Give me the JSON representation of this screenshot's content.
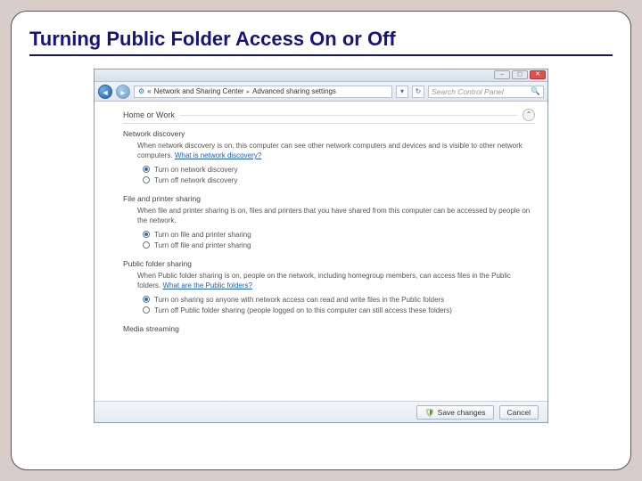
{
  "slide": {
    "title": "Turning Public Folder Access On or Off"
  },
  "toolbar": {
    "crumb_prefix": "«",
    "crumb_1": "Network and Sharing Center",
    "crumb_2": "Advanced sharing settings",
    "search_placeholder": "Search Control Panel"
  },
  "profile": {
    "name": "Home or Work"
  },
  "sections": {
    "discovery": {
      "title": "Network discovery",
      "desc": "When network discovery is on, this computer can see other network computers and devices and is visible to other network computers.",
      "link": "What is network discovery?",
      "opt_on": "Turn on network discovery",
      "opt_off": "Turn off network discovery"
    },
    "fileprint": {
      "title": "File and printer sharing",
      "desc": "When file and printer sharing is on, files and printers that you have shared from this computer can be accessed by people on the network.",
      "opt_on": "Turn on file and printer sharing",
      "opt_off": "Turn off file and printer sharing"
    },
    "publicfolder": {
      "title": "Public folder sharing",
      "desc": "When Public folder sharing is on, people on the network, including homegroup members, can access files in the Public folders.",
      "link": "What are the Public folders?",
      "opt_on": "Turn on sharing so anyone with network access can read and write files in the Public folders",
      "opt_off": "Turn off Public folder sharing (people logged on to this computer can still access these folders)"
    },
    "media": {
      "title": "Media streaming"
    }
  },
  "footer": {
    "save": "Save changes",
    "cancel": "Cancel"
  }
}
